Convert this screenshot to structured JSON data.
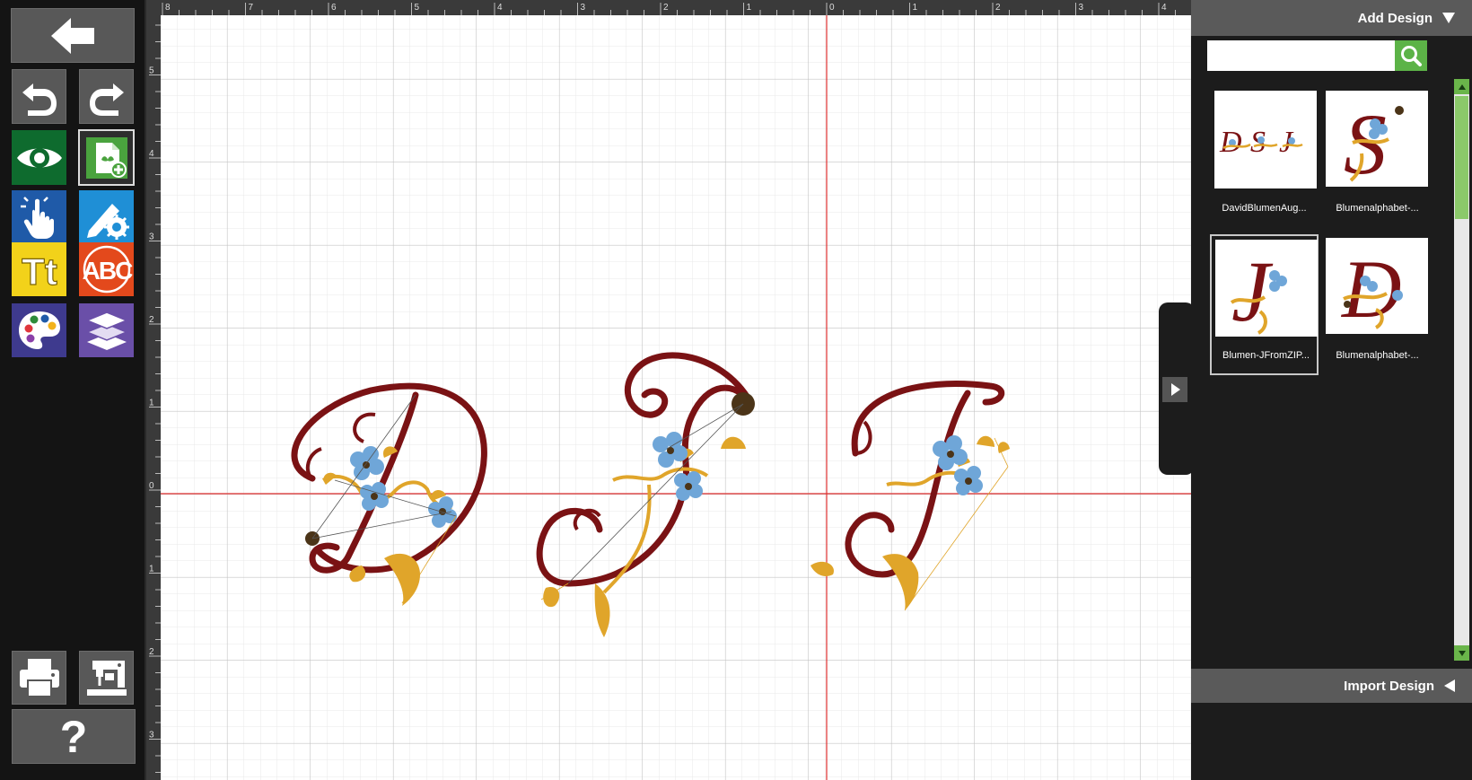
{
  "toolbar": {
    "buttons": [
      {
        "name": "back-button",
        "icon": "arrow-left-icon"
      },
      {
        "name": "undo-button",
        "icon": "undo-icon"
      },
      {
        "name": "redo-button",
        "icon": "redo-icon"
      },
      {
        "name": "preview-button",
        "icon": "eye-icon",
        "color": "#0e6b2e"
      },
      {
        "name": "add-design-button",
        "icon": "add-design-icon",
        "color": "#4aa33e"
      },
      {
        "name": "select-button",
        "icon": "hand-pointer-icon",
        "color": "#1f5aa8"
      },
      {
        "name": "edit-button",
        "icon": "pencil-gear-icon",
        "color": "#1f8fd6"
      },
      {
        "name": "text-button",
        "icon": "text-icon",
        "label": "Tt",
        "color": "#f2d21a"
      },
      {
        "name": "monogram-button",
        "icon": "monogram-icon",
        "label": "ABC",
        "color": "#e3491c"
      },
      {
        "name": "color-button",
        "icon": "palette-icon",
        "color": "#3e3a8e"
      },
      {
        "name": "layers-button",
        "icon": "layers-icon",
        "color": "#6a4fa8"
      },
      {
        "name": "print-button",
        "icon": "printer-icon"
      },
      {
        "name": "sew-button",
        "icon": "sewing-machine-icon"
      },
      {
        "name": "help-button",
        "icon": "question-icon",
        "label": "?"
      }
    ]
  },
  "canvas": {
    "top_ruler_labels": [
      "8",
      "7",
      "6",
      "5",
      "4",
      "3",
      "2",
      "1",
      "0",
      "1",
      "2",
      "3",
      "4"
    ],
    "left_ruler_labels": [
      "5",
      "4",
      "3",
      "2",
      "1",
      "0",
      "1",
      "2",
      "3"
    ],
    "design_letters": [
      "D",
      "S",
      "J"
    ],
    "colors": {
      "thread_maroon": "#7a1214",
      "thread_gold": "#e0a52a",
      "thread_blue": "#6fa6d8",
      "thread_brown": "#4b3418",
      "center_line": "#e03030",
      "grid_minor": "#e6e6e6",
      "grid_major": "#c4c4c4"
    }
  },
  "panel": {
    "add_design_title": "Add Design",
    "import_design_title": "Import Design",
    "search_placeholder": "",
    "designs": [
      {
        "label": "DavidBlumenAug...",
        "letters": "DSJ",
        "selected": false
      },
      {
        "label": "Blumenalphabet-...",
        "letters": "S",
        "selected": false
      },
      {
        "label": "Blumen-JFromZIP...",
        "letters": "J",
        "selected": true
      },
      {
        "label": "Blumenalphabet-...",
        "letters": "D",
        "selected": false
      }
    ]
  }
}
